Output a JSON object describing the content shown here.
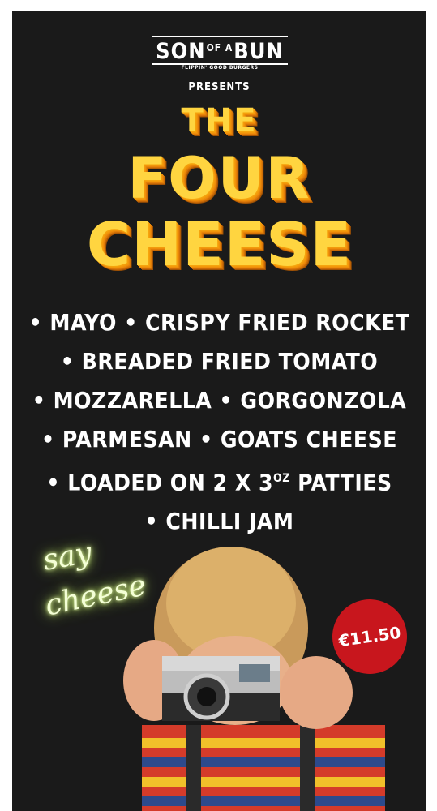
{
  "logo": {
    "word1": "SON",
    "of": "OF A",
    "word2": "BUN",
    "tagline": "FLIPPIN' GOOD BURGERS"
  },
  "presents": "PRESENTS",
  "title": {
    "line1": "THE",
    "line2": "FOUR",
    "line3": "CHEESE"
  },
  "ingredients": {
    "line1": "• MAYO • CRISPY FRIED ROCKET",
    "line2": "• BREADED FRIED TOMATO",
    "line3": "• MOZZARELLA • GORGONZOLA",
    "line4": "• PARMESAN • GOATS CHEESE",
    "line5_prefix": "• LOADED ON 2 X 3",
    "line5_sup": "OZ",
    "line5_suffix": " PATTIES",
    "line6": "• CHILLI JAM"
  },
  "neon": {
    "line1": "say",
    "line2": "cheese"
  },
  "price": "€11.50",
  "colors": {
    "background": "#1a1a1a",
    "title_fill": "#ffd540",
    "title_shadow": "#e07c08",
    "badge": "#c8161d",
    "neon": "#e8ffa8"
  }
}
